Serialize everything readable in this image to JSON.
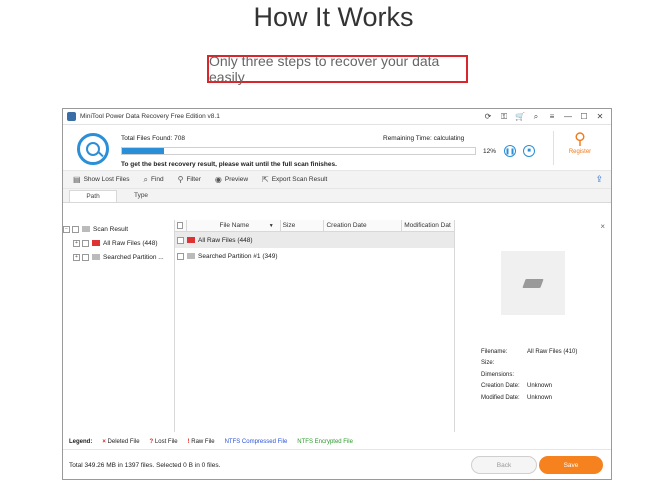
{
  "page": {
    "heading": "How It Works",
    "subtitle": "Only three steps to recover your data easily"
  },
  "window": {
    "title": "MiniTool Power Data Recovery Free Edition v8.1",
    "title_icons": [
      "reload-icon",
      "key-icon",
      "cart-icon",
      "zoom-icon",
      "menu-icon"
    ],
    "minimize": "—",
    "maximize": "☐",
    "close": "✕"
  },
  "scan": {
    "total_files_found": "Total Files Found:  708",
    "remaining_time": "Remaining Time:  calculating",
    "progress_percent": 12,
    "percent_label": "12%",
    "message": "To get the best recovery result, please wait until the full scan finishes.",
    "register_label": "Register"
  },
  "toolbar": {
    "show_lost_files": "Show Lost Files",
    "find": "Find",
    "filter": "Filter",
    "preview": "Preview",
    "export_scan_result": "Export Scan Result"
  },
  "tabs": [
    {
      "label": "Path",
      "active": true
    },
    {
      "label": "Type",
      "active": false
    }
  ],
  "tree": {
    "root": "Scan Result",
    "items": [
      {
        "label": "All Raw Files (448)"
      },
      {
        "label": "Searched Partition ..."
      }
    ]
  },
  "filelist": {
    "headers": {
      "file_name": "File Name",
      "size": "Size",
      "creation_date": "Creation Date",
      "modification_date": "Modification Dat"
    },
    "rows": [
      {
        "name": "All Raw Files (448)"
      },
      {
        "name": "Searched Partition #1 (349)"
      }
    ]
  },
  "preview": {
    "close": "×",
    "filename_label": "Filename:",
    "filename_value": "All Raw Files (410)",
    "size_label": "Size:",
    "size_value": "",
    "dimensions_label": "Dimensions:",
    "dimensions_value": "",
    "creation_label": "Creation Date:",
    "creation_value": "Unknown",
    "modified_label": "Modified Date:",
    "modified_value": "Unknown"
  },
  "legend": {
    "label": "Legend:",
    "deleted": "Deleted File",
    "lost": "Lost File",
    "raw": "Raw File",
    "ntfs_compressed": "NTFS Compressed File",
    "ntfs_encrypted": "NTFS Encrypted File"
  },
  "bottom": {
    "total": "Total 349.26 MB in 1397 files.  Selected 0 B in 0 files.",
    "back": "Back",
    "save": "Save"
  },
  "colors": {
    "accent_blue": "#2a8fd6",
    "highlight_red": "#d9262a",
    "save_orange": "#f5821f",
    "ntfs_compressed": "#2a52d8",
    "ntfs_encrypted": "#2a9a2a"
  }
}
